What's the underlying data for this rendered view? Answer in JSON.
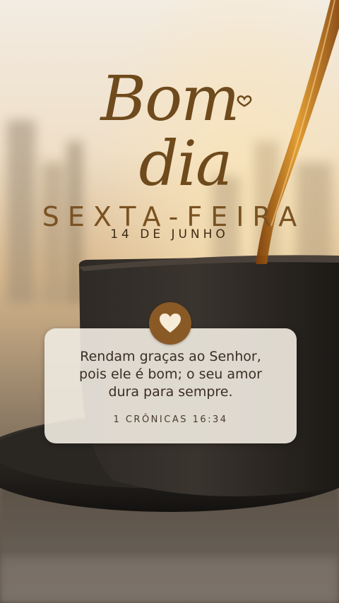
{
  "greeting": {
    "line1": "Bom",
    "line2": "dia"
  },
  "weekday": "SEXTA-FEIRA",
  "date": "14 DE JUNHO",
  "verse": {
    "lines": [
      "Rendam graças ao Senhor,",
      "pois ele é bom; o seu amor",
      "dura para sempre."
    ],
    "reference": "1 CRÔNICAS 16:34"
  },
  "icons": {
    "badge": "heart-icon",
    "flourish": "small-heart-icon"
  },
  "colors": {
    "accent": "#8a5a26",
    "title": "#7a5222",
    "card": "#eee8de",
    "text": "#3a2e22"
  }
}
